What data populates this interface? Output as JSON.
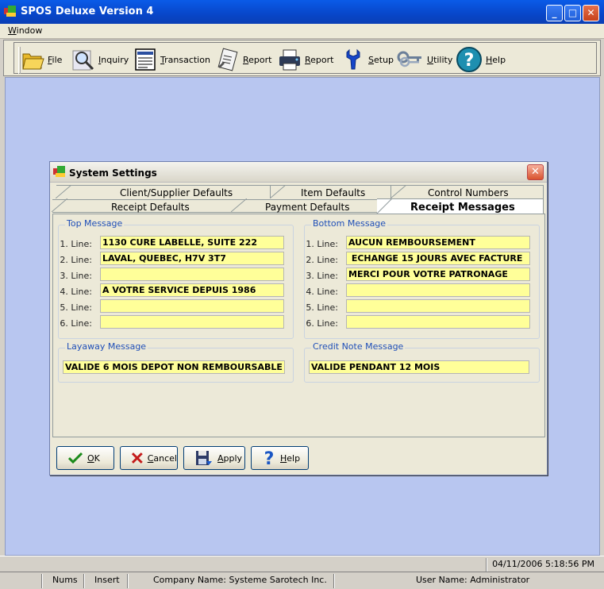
{
  "window": {
    "title": "SPOS Deluxe Version 4",
    "minimize": "_",
    "maximize": "□",
    "close": "✕"
  },
  "menu": {
    "window": "Window"
  },
  "toolbar": {
    "items": [
      {
        "label": "File",
        "icon": "folder-icon"
      },
      {
        "label": "Inquiry",
        "icon": "magnifier-icon"
      },
      {
        "label": "Transaction",
        "icon": "document-icon"
      },
      {
        "label": "Report",
        "icon": "clipboard-icon"
      },
      {
        "label": "Report",
        "icon": "printer-icon"
      },
      {
        "label": "Setup",
        "icon": "wrench-icon"
      },
      {
        "label": "Utility",
        "icon": "keys-icon"
      },
      {
        "label": "Help",
        "icon": "help-icon"
      }
    ]
  },
  "dialog": {
    "title": "System Settings",
    "close": "✕",
    "tabs_back": [
      "Client/Supplier Defaults",
      "Item Defaults",
      "Control Numbers"
    ],
    "tabs_front": [
      "Receipt Defaults",
      "Payment Defaults",
      "Receipt Messages"
    ],
    "top_message": {
      "title": "Top Message",
      "lines": [
        {
          "label": "1. Line:",
          "value": "1130 CURE LABELLE, SUITE 222"
        },
        {
          "label": "2. Line:",
          "value": "LAVAL, QUEBEC, H7V 3T7"
        },
        {
          "label": "3. Line:",
          "value": ""
        },
        {
          "label": "4. Line:",
          "value": "A VOTRE SERVICE DEPUIS 1986"
        },
        {
          "label": "5. Line:",
          "value": ""
        },
        {
          "label": "6. Line:",
          "value": ""
        }
      ]
    },
    "bottom_message": {
      "title": "Bottom Message",
      "lines": [
        {
          "label": "1. Line:",
          "value": "AUCUN REMBOURSEMENT"
        },
        {
          "label": "2. Line:",
          "value": " ECHANGE 15 JOURS AVEC FACTURE"
        },
        {
          "label": "3. Line:",
          "value": "MERCI POUR VOTRE PATRONAGE"
        },
        {
          "label": "4. Line:",
          "value": ""
        },
        {
          "label": "5. Line:",
          "value": ""
        },
        {
          "label": "6. Line:",
          "value": ""
        }
      ]
    },
    "layaway": {
      "title": "Layaway Message",
      "value": "VALIDE 6 MOIS DEPOT NON REMBOURSABLE"
    },
    "credit_note": {
      "title": "Credit Note Message",
      "value": "VALIDE PENDANT 12 MOIS"
    },
    "buttons": {
      "ok": "OK",
      "cancel": "Cancel",
      "apply": "Apply",
      "help": "Help"
    }
  },
  "status": {
    "datetime": "04/11/2006  5:18:56 PM",
    "nums": "Nums",
    "insert": "Insert",
    "company": "Company Name: Systeme Sarotech Inc.",
    "user": "User Name: Administrator"
  }
}
